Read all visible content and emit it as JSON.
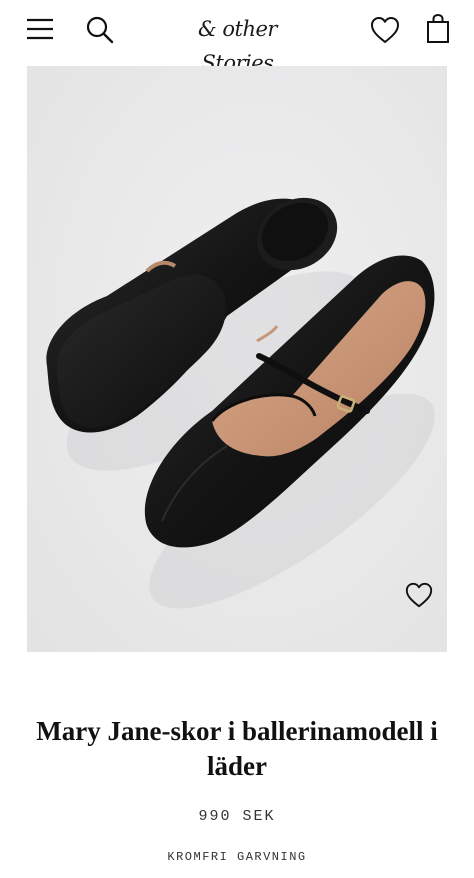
{
  "header": {
    "menu_icon": "hamburger-menu-icon",
    "search_icon": "search-icon",
    "logo_text": "& other Stories",
    "wishlist_icon": "heart-icon",
    "bag_icon": "shopping-bag-icon"
  },
  "product": {
    "image_alt": "Mary Jane-skor i ballerinamodell i läder",
    "wishlist_icon": "heart-icon",
    "title": "Mary Jane-skor i ballerinamodell i läder",
    "price": "990 SEK",
    "feature": "KROMFRI GARVNING"
  },
  "colors": {
    "background": "#ffffff",
    "image_background": "#e9e9ea",
    "text": "#111111",
    "shoe": "#161616"
  }
}
